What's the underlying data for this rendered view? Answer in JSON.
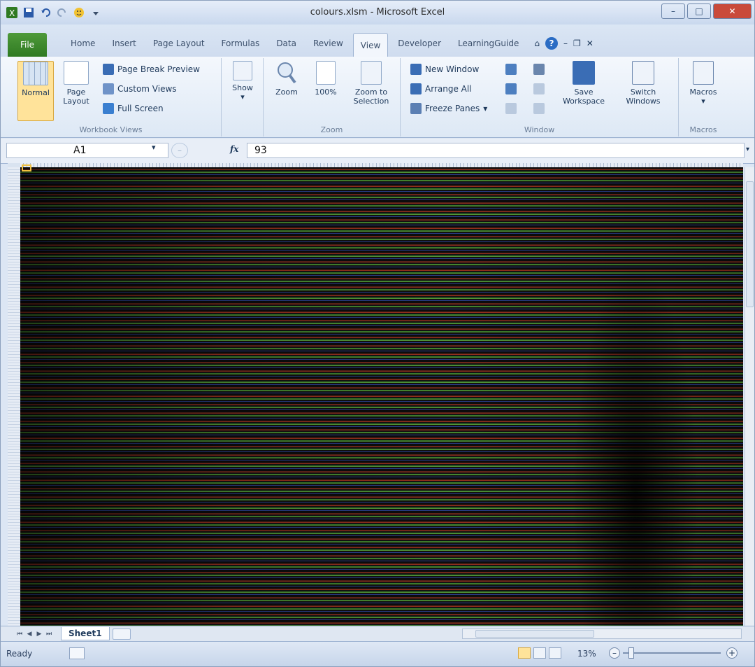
{
  "window": {
    "title": "colours.xlsm - Microsoft Excel"
  },
  "quick_access": {
    "undo_icon": "undo-icon",
    "redo_icon": "redo-icon",
    "save_icon": "save-icon",
    "smiley_icon": "smiley-icon"
  },
  "tabs": [
    "File",
    "Home",
    "Insert",
    "Page Layout",
    "Formulas",
    "Data",
    "Review",
    "View",
    "Developer",
    "LearningGuide"
  ],
  "active_tab": "View",
  "ribbon": {
    "workbook_views": {
      "label": "Workbook Views",
      "normal": "Normal",
      "page_layout": "Page Layout",
      "page_break_preview": "Page Break Preview",
      "custom_views": "Custom Views",
      "full_screen": "Full Screen"
    },
    "show": {
      "label": "Show"
    },
    "zoom": {
      "label": "Zoom",
      "zoom": "Zoom",
      "hundred": "100%",
      "zoom_to_selection": "Zoom to Selection"
    },
    "window": {
      "label": "Window",
      "new_window": "New Window",
      "arrange_all": "Arrange All",
      "freeze_panes": "Freeze Panes",
      "save_workspace": "Save Workspace",
      "switch_windows": "Switch Windows"
    },
    "macros": {
      "label": "Macros",
      "macros": "Macros"
    }
  },
  "formula_bar": {
    "name_box": "A1",
    "fx": "fx",
    "value": "93"
  },
  "sheet_tabs": {
    "active": "Sheet1"
  },
  "status": {
    "ready": "Ready",
    "zoom": "13%"
  },
  "colors": {
    "accent": "#2f7a22",
    "ribbon_bg": "#dde8f5"
  }
}
